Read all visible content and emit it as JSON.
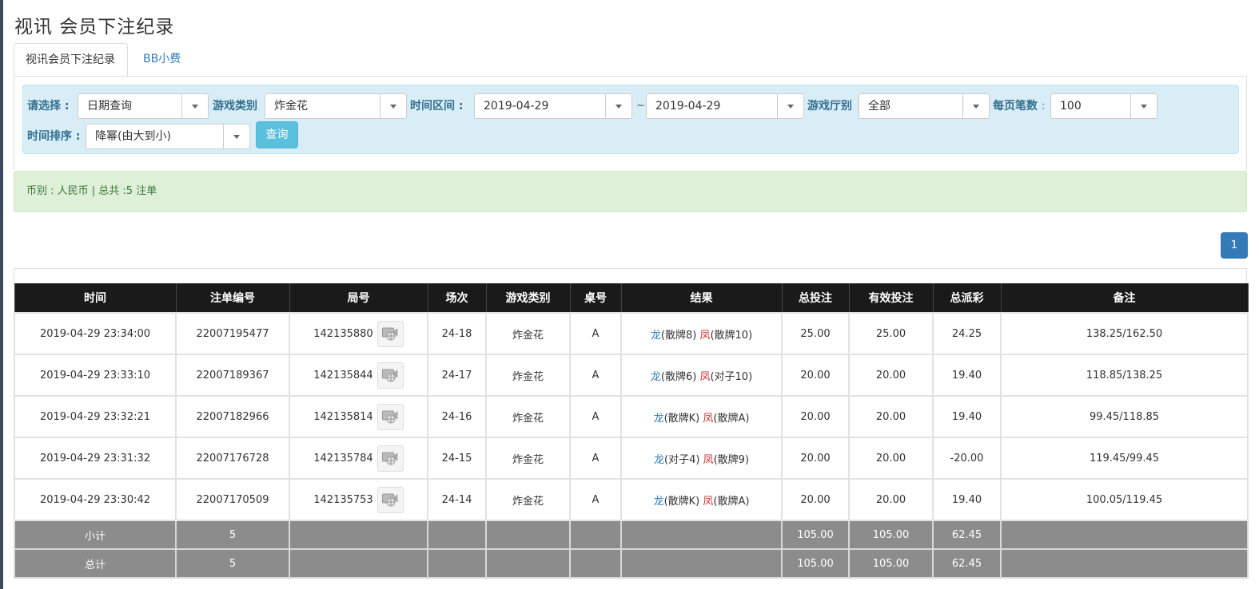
{
  "page": {
    "title": "视讯 会员下注纪录"
  },
  "tabs": [
    {
      "label": "视讯会员下注纪录",
      "active": true
    },
    {
      "label": "BB小费",
      "active": false
    }
  ],
  "filters": {
    "select_label": "请选择 :",
    "select_value": "日期查询",
    "game_type_label": "游戏类别",
    "game_type_value": "炸金花",
    "time_range_label": "时间区间 :",
    "date_from": "2019-04-29",
    "date_sep": "~",
    "date_to": "2019-04-29",
    "hall_label": "游戏厅别",
    "hall_value": "全部",
    "per_page_label": "每页笔数",
    "per_page_sep": ":",
    "per_page_value": "100",
    "sort_label": "时间排序 :",
    "sort_value": "降幂(由大到小)",
    "query_button": "查询"
  },
  "summary": {
    "text": "币别 : 人民币 | 总共 :5 注单"
  },
  "pagination": {
    "current": "1"
  },
  "table": {
    "headers": [
      "时间",
      "注单编号",
      "局号",
      "场次",
      "游戏类别",
      "桌号",
      "结果",
      "总投注",
      "有效投注",
      "总派彩",
      "备注"
    ],
    "rows": [
      {
        "time": "2019-04-29 23:34:00",
        "bet_id": "22007195477",
        "round": "142135880",
        "session": "24-18",
        "game": "炸金花",
        "table": "A",
        "dragon": "龙",
        "dragon_hand": "(散牌8) ",
        "phoenix": "凤",
        "phoenix_hand": "(散牌10)",
        "total_bet": "25.00",
        "valid_bet": "25.00",
        "payout": "24.25",
        "payout_negative": false,
        "note": "138.25/162.50"
      },
      {
        "time": "2019-04-29 23:33:10",
        "bet_id": "22007189367",
        "round": "142135844",
        "session": "24-17",
        "game": "炸金花",
        "table": "A",
        "dragon": "龙",
        "dragon_hand": "(散牌6) ",
        "phoenix": "凤",
        "phoenix_hand": "(对子10)",
        "total_bet": "20.00",
        "valid_bet": "20.00",
        "payout": "19.40",
        "payout_negative": false,
        "note": "118.85/138.25"
      },
      {
        "time": "2019-04-29 23:32:21",
        "bet_id": "22007182966",
        "round": "142135814",
        "session": "24-16",
        "game": "炸金花",
        "table": "A",
        "dragon": "龙",
        "dragon_hand": "(散牌K) ",
        "phoenix": "凤",
        "phoenix_hand": "(散牌A)",
        "total_bet": "20.00",
        "valid_bet": "20.00",
        "payout": "19.40",
        "payout_negative": false,
        "note": "99.45/118.85"
      },
      {
        "time": "2019-04-29 23:31:32",
        "bet_id": "22007176728",
        "round": "142135784",
        "session": "24-15",
        "game": "炸金花",
        "table": "A",
        "dragon": "龙",
        "dragon_hand": "(对子4) ",
        "phoenix": "凤",
        "phoenix_hand": "(散牌9)",
        "total_bet": "20.00",
        "valid_bet": "20.00",
        "payout": "-20.00",
        "payout_negative": true,
        "note": "119.45/99.45"
      },
      {
        "time": "2019-04-29 23:30:42",
        "bet_id": "22007170509",
        "round": "142135753",
        "session": "24-14",
        "game": "炸金花",
        "table": "A",
        "dragon": "龙",
        "dragon_hand": "(散牌K) ",
        "phoenix": "凤",
        "phoenix_hand": "(散牌A)",
        "total_bet": "20.00",
        "valid_bet": "20.00",
        "payout": "19.40",
        "payout_negative": false,
        "note": "100.05/119.45"
      }
    ],
    "subtotal": {
      "label": "小计",
      "count": "5",
      "total_bet": "105.00",
      "valid_bet": "105.00",
      "payout": "62.45"
    },
    "total": {
      "label": "总计",
      "count": "5",
      "total_bet": "105.00",
      "valid_bet": "105.00",
      "payout": "62.45"
    }
  },
  "colors": {
    "header_bg": "#1a1a1a",
    "link_blue": "#337ab7",
    "negative_red": "#c9302c",
    "info_bg": "#d9edf7",
    "success_bg": "#dff0d8",
    "summary_row_bg": "#8c8c8c"
  },
  "icons": {
    "round_detail": "video-replay-icon",
    "caret": "caret-down-icon"
  }
}
